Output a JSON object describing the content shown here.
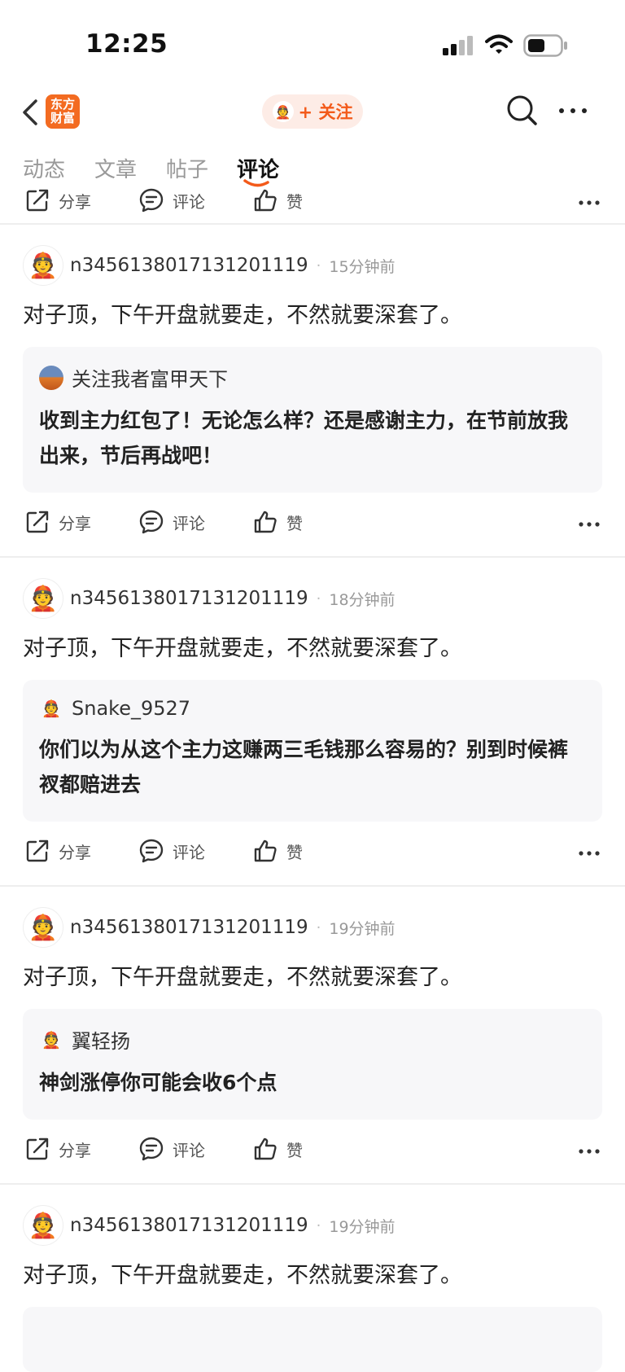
{
  "status_bar": {
    "time": "12:25"
  },
  "nav": {
    "logo_line1": "东方",
    "logo_line2": "财富",
    "follow_label": "+ 关注"
  },
  "tabs": [
    {
      "label": "动态"
    },
    {
      "label": "文章"
    },
    {
      "label": "帖子"
    },
    {
      "label": "评论",
      "active": true
    }
  ],
  "actions": {
    "share": "分享",
    "comment": "评论",
    "like": "赞"
  },
  "posts": [
    {
      "username": "n3456138017131201119",
      "time": "15分钟前",
      "content": "对子顶，下午开盘就要走，不然就要深套了。",
      "quote_user": "关注我者富甲天下",
      "quote_text": "收到主力红包了！无论怎么样？还是感谢主力，在节前放我出来，节后再战吧！"
    },
    {
      "username": "n3456138017131201119",
      "time": "18分钟前",
      "content": "对子顶，下午开盘就要走，不然就要深套了。",
      "quote_user": "Snake_9527",
      "quote_text": "你们以为从这个主力这赚两三毛钱那么容易的？别到时候裤衩都赔进去"
    },
    {
      "username": "n3456138017131201119",
      "time": "19分钟前",
      "content": "对子顶，下午开盘就要走，不然就要深套了。",
      "quote_user": "翼轻扬",
      "quote_text": "神剑涨停你可能会收6个点"
    },
    {
      "username": "n3456138017131201119",
      "time": "19分钟前",
      "content": "对子顶，下午开盘就要走，不然就要深套了。"
    }
  ],
  "colors": {
    "accent": "#f35a1a",
    "brand": "#f36b21",
    "quote_bg": "#f7f7f9"
  }
}
